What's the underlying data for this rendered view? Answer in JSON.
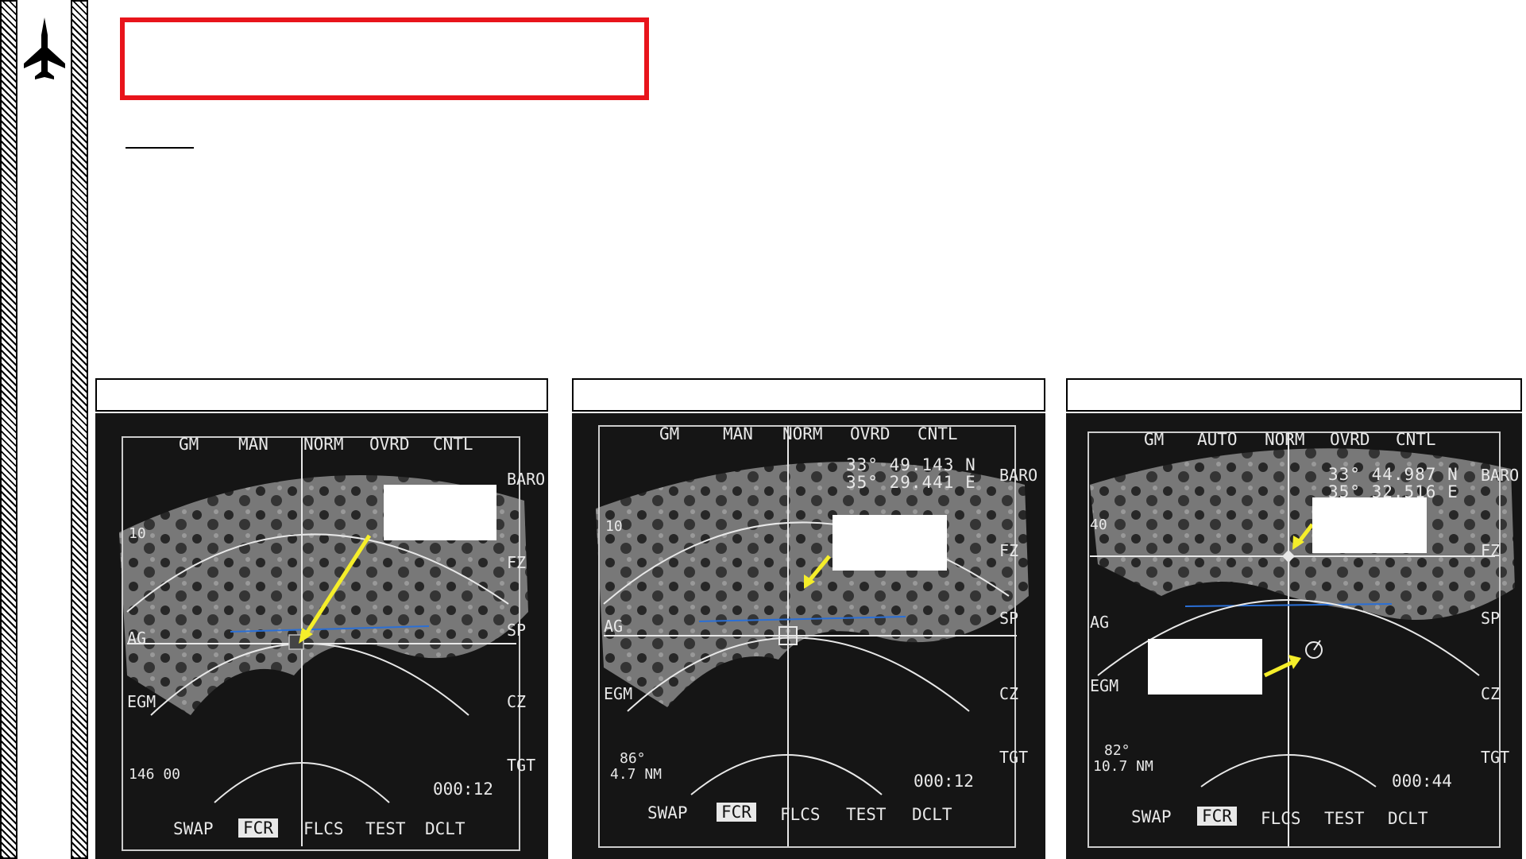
{
  "panels": [
    {
      "osb_top": [
        "GM",
        "MAN",
        "NORM",
        "OVRD",
        "CNTL"
      ],
      "osb_bottom": [
        "SWAP",
        "FCR",
        "FLCS",
        "TEST",
        "DCLT"
      ],
      "osb_right": [
        "BARO",
        "FZ",
        "SP",
        "CZ",
        "TGT"
      ],
      "osb_left": [
        "AG",
        "EGM"
      ],
      "range": "10",
      "coord_lat": "",
      "coord_lon": "",
      "bearing": "146 00",
      "range_nm": "",
      "timer": "000:12"
    },
    {
      "osb_top": [
        "GM",
        "MAN",
        "NORM",
        "OVRD",
        "CNTL"
      ],
      "osb_bottom": [
        "SWAP",
        "FCR",
        "FLCS",
        "TEST",
        "DCLT"
      ],
      "osb_right": [
        "BARO",
        "FZ",
        "SP",
        "CZ",
        "TGT"
      ],
      "osb_left": [
        "AG",
        "EGM"
      ],
      "range": "10",
      "coord_lat": "33° 49.143 N",
      "coord_lon": "35° 29.441 E",
      "bearing": "86°",
      "range_nm": "4.7 NM",
      "timer": "000:12"
    },
    {
      "osb_top": [
        "GM",
        "AUTO",
        "NORM",
        "OVRD",
        "CNTL"
      ],
      "osb_bottom": [
        "SWAP",
        "FCR",
        "FLCS",
        "TEST",
        "DCLT"
      ],
      "osb_right": [
        "BARO",
        "FZ",
        "SP",
        "CZ",
        "TGT"
      ],
      "osb_left": [
        "AG",
        "EGM"
      ],
      "range": "40",
      "coord_lat": "33° 44.987 N",
      "coord_lon": "35° 32.516 E",
      "bearing": "82°",
      "range_nm": "10.7 NM",
      "timer": "000:44"
    }
  ],
  "colors": {
    "title_border": "#e8141b",
    "arrow": "#f5ee2a",
    "symbology": "#e8e8e8",
    "horizon_line": "#2a6fd6"
  },
  "icons": {
    "logo": "fighter-jet-icon"
  }
}
